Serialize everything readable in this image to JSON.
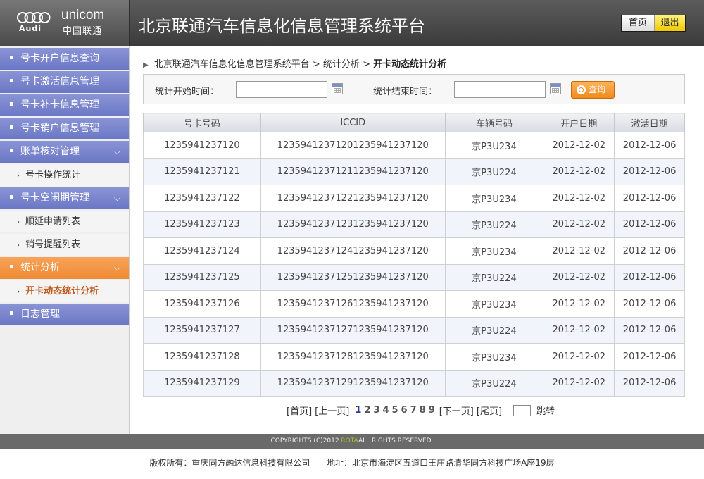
{
  "header": {
    "logo_audi": "Audi",
    "logo_unicom_en": "unicom",
    "logo_unicom_cn": "中国联通",
    "title": "北京联通汽车信息化信息管理系统平台",
    "home_label": "首页",
    "exit_label": "退出"
  },
  "sidebar": {
    "items": [
      {
        "label": "号卡开户信息查询"
      },
      {
        "label": "号卡激活信息管理"
      },
      {
        "label": "号卡补卡信息管理"
      },
      {
        "label": "号卡销户信息管理"
      },
      {
        "label": "账单核对管理"
      },
      {
        "label": "号卡操作统计"
      },
      {
        "label": "号卡空闲期管理"
      },
      {
        "label": "顺延申请列表"
      },
      {
        "label": "销号提醒列表"
      },
      {
        "label": "统计分析"
      },
      {
        "label": "开卡动态统计分析"
      },
      {
        "label": "日志管理"
      }
    ]
  },
  "breadcrumb": {
    "root": "北京联通汽车信息化信息管理系统平台",
    "sep1": ">",
    "parent": "统计分析",
    "sep2": ">",
    "current": "开卡动态统计分析"
  },
  "search": {
    "start_label": "统计开始时间：",
    "start_value": "",
    "end_label": "统计结束时间：",
    "end_value": "",
    "query_label": "查询"
  },
  "table": {
    "columns": [
      "号卡号码",
      "ICCID",
      "车辆号码",
      "开户日期",
      "激活日期"
    ],
    "rows": [
      [
        "1235941237120",
        "12359412371201235941237120",
        "京P3U234",
        "2012-12-02",
        "2012-12-06"
      ],
      [
        "1235941237121",
        "12359412371211235941237120",
        "京P3U224",
        "2012-12-02",
        "2012-12-06"
      ],
      [
        "1235941237122",
        "12359412371221235941237120",
        "京P3U234",
        "2012-12-02",
        "2012-12-06"
      ],
      [
        "1235941237123",
        "12359412371231235941237120",
        "京P3U224",
        "2012-12-02",
        "2012-12-06"
      ],
      [
        "1235941237124",
        "12359412371241235941237120",
        "京P3U234",
        "2012-12-02",
        "2012-12-06"
      ],
      [
        "1235941237125",
        "12359412371251235941237120",
        "京P3U224",
        "2012-12-02",
        "2012-12-06"
      ],
      [
        "1235941237126",
        "12359412371261235941237120",
        "京P3U234",
        "2012-12-02",
        "2012-12-06"
      ],
      [
        "1235941237127",
        "12359412371271235941237120",
        "京P3U224",
        "2012-12-02",
        "2012-12-06"
      ],
      [
        "1235941237128",
        "12359412371281235941237120",
        "京P3U234",
        "2012-12-02",
        "2012-12-06"
      ],
      [
        "1235941237129",
        "12359412371291235941237120",
        "京P3U224",
        "2012-12-02",
        "2012-12-06"
      ]
    ]
  },
  "pager": {
    "first": "[首页]",
    "prev": "[上一页]",
    "pages": [
      "1",
      "2",
      "3",
      "4",
      "5",
      "6",
      "7",
      "8",
      "9"
    ],
    "current_page": "1",
    "next": "[下一页]",
    "last": "[尾页]",
    "jump_value": "",
    "jump_label": "跳转"
  },
  "footer": {
    "copyright_pre": "COPYRIGHTS (C)2012 ",
    "copyright_brand": "ROTA",
    "copyright_post": "ALL RIGHTS RESERVED.",
    "owner": "版权所有：重庆同方融达信息科技有限公司",
    "address": "地址：北京市海淀区五道口王庄路清华同方科技广场A座19层"
  },
  "colors": {
    "menu_blue": "#7a85cd",
    "menu_active": "#f29443",
    "active_sub_text": "#c0561a",
    "header_bg": "#4a4a4a",
    "exit_button": "#f5d400"
  }
}
